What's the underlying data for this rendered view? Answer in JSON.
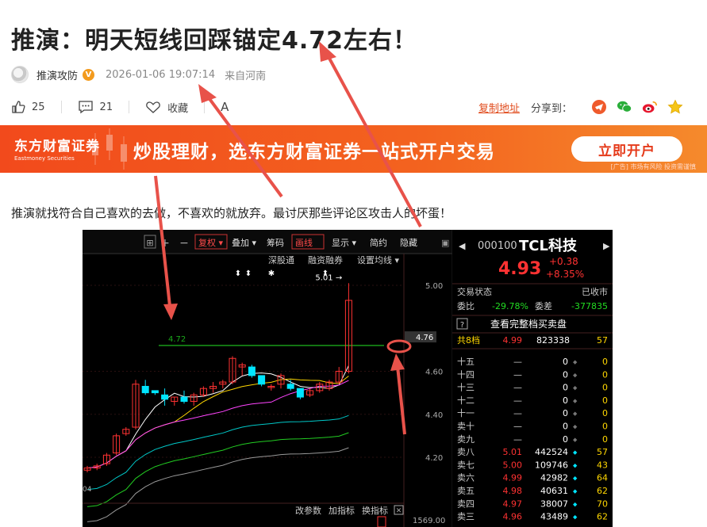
{
  "article": {
    "title": "推演：明天短线回踩锚定4.72左右！",
    "author": "推演攻防",
    "verified_badge": "V",
    "time": "2026-01-06 19:07:14",
    "location": "来自河南",
    "likes": "25",
    "comments": "21",
    "collect_label": "收藏",
    "font_size_label": "A",
    "copy_link": "复制地址",
    "share_label": "分享到："
  },
  "banner": {
    "brand_cn": "东方财富证券",
    "brand_en": "Eastmoney Securities",
    "slogan": "炒股理财，选东方财富证券一站式开户交易",
    "button": "立即开户",
    "ad_note": "[广告] 市场有风险 投资需谨慎"
  },
  "paragraph": "推演就找符合自己喜欢的去做，不喜欢的就放弃。最讨厌那些评论区攻击人的坏蛋！",
  "chart": {
    "toolbar": [
      "复权",
      "叠加",
      "筹码",
      "画线",
      "显示",
      "简约",
      "隐藏"
    ],
    "sub_toolbar": [
      "深股通",
      "融资融券",
      "设置均线"
    ],
    "top_label": "5.01",
    "line_label": "4.72",
    "y_ticks": [
      "5.00",
      "4.76",
      "4.60",
      "4.40",
      "4.20"
    ],
    "bottom_tools": [
      "改参数",
      "加指标",
      "换指标"
    ],
    "vol_label": "1569.00",
    "date_label": "04",
    "colors": {
      "up": "#ff3232",
      "down": "#00e5ff",
      "line": "#1aa81a"
    }
  },
  "chart_data": {
    "type": "candlestick",
    "ylim": [
      4.1,
      5.1
    ],
    "reference_line": 4.72,
    "high_label": 5.01,
    "candles": [
      {
        "o": 4.14,
        "h": 4.16,
        "l": 4.13,
        "c": 4.15
      },
      {
        "o": 4.15,
        "h": 4.17,
        "l": 4.14,
        "c": 4.16
      },
      {
        "o": 4.17,
        "h": 4.22,
        "l": 4.16,
        "c": 4.21
      },
      {
        "o": 4.22,
        "h": 4.31,
        "l": 4.21,
        "c": 4.3
      },
      {
        "o": 4.31,
        "h": 4.34,
        "l": 4.3,
        "c": 4.33
      },
      {
        "o": 4.34,
        "h": 4.56,
        "l": 4.33,
        "c": 4.54
      },
      {
        "o": 4.53,
        "h": 4.56,
        "l": 4.49,
        "c": 4.5
      },
      {
        "o": 4.51,
        "h": 4.51,
        "l": 4.49,
        "c": 4.5
      },
      {
        "o": 4.49,
        "h": 4.52,
        "l": 4.44,
        "c": 4.47
      },
      {
        "o": 4.46,
        "h": 4.48,
        "l": 4.44,
        "c": 4.48
      },
      {
        "o": 4.48,
        "h": 4.51,
        "l": 4.45,
        "c": 4.46
      },
      {
        "o": 4.46,
        "h": 4.5,
        "l": 4.44,
        "c": 4.49
      },
      {
        "o": 4.49,
        "h": 4.53,
        "l": 4.48,
        "c": 4.52
      },
      {
        "o": 4.52,
        "h": 4.55,
        "l": 4.5,
        "c": 4.53
      },
      {
        "o": 4.54,
        "h": 4.56,
        "l": 4.52,
        "c": 4.55
      },
      {
        "o": 4.55,
        "h": 4.67,
        "l": 4.54,
        "c": 4.66
      },
      {
        "o": 4.62,
        "h": 4.64,
        "l": 4.58,
        "c": 4.63
      },
      {
        "o": 4.62,
        "h": 4.63,
        "l": 4.57,
        "c": 4.58
      },
      {
        "o": 4.58,
        "h": 4.58,
        "l": 4.53,
        "c": 4.54
      },
      {
        "o": 4.53,
        "h": 4.54,
        "l": 4.51,
        "c": 4.53
      },
      {
        "o": 4.54,
        "h": 4.59,
        "l": 4.52,
        "c": 4.58
      },
      {
        "o": 4.54,
        "h": 4.56,
        "l": 4.51,
        "c": 4.52
      },
      {
        "o": 4.52,
        "h": 4.52,
        "l": 4.47,
        "c": 4.48
      },
      {
        "o": 4.49,
        "h": 4.52,
        "l": 4.48,
        "c": 4.51
      },
      {
        "o": 4.51,
        "h": 4.55,
        "l": 4.5,
        "c": 4.54
      },
      {
        "o": 4.52,
        "h": 4.56,
        "l": 4.51,
        "c": 4.55
      },
      {
        "o": 4.55,
        "h": 4.62,
        "l": 4.54,
        "c": 4.6
      },
      {
        "o": 4.6,
        "h": 5.01,
        "l": 4.59,
        "c": 4.93
      }
    ]
  },
  "quote": {
    "code": "000100",
    "name": "TCL科技",
    "price": "4.93",
    "change": "+0.38",
    "pct": "+8.35%",
    "status_label": "交易状态",
    "status": "已收市",
    "weibi_label": "委比",
    "weibi": "-29.78%",
    "weicha_label": "委差",
    "weicha": "-377835",
    "full_book": "查看完整档买卖盘",
    "tier_label": "共8档",
    "tier_price": "4.99",
    "tier_vol": "823338",
    "tier_cnt": "57",
    "book": [
      {
        "label": "十五",
        "price": "—",
        "vol": "0",
        "cnt": "0"
      },
      {
        "label": "十四",
        "price": "—",
        "vol": "0",
        "cnt": "0"
      },
      {
        "label": "十三",
        "price": "—",
        "vol": "0",
        "cnt": "0"
      },
      {
        "label": "十二",
        "price": "—",
        "vol": "0",
        "cnt": "0"
      },
      {
        "label": "十一",
        "price": "—",
        "vol": "0",
        "cnt": "0"
      },
      {
        "label": "卖十",
        "price": "—",
        "vol": "0",
        "cnt": "0"
      },
      {
        "label": "卖九",
        "price": "—",
        "vol": "0",
        "cnt": "0"
      },
      {
        "label": "卖八",
        "price": "5.01",
        "vol": "442524",
        "cnt": "57"
      },
      {
        "label": "卖七",
        "price": "5.00",
        "vol": "109746",
        "cnt": "43"
      },
      {
        "label": "卖六",
        "price": "4.99",
        "vol": "42982",
        "cnt": "64"
      },
      {
        "label": "卖五",
        "price": "4.98",
        "vol": "40631",
        "cnt": "62"
      },
      {
        "label": "卖四",
        "price": "4.97",
        "vol": "38007",
        "cnt": "70"
      },
      {
        "label": "卖三",
        "price": "4.96",
        "vol": "43489",
        "cnt": "62"
      }
    ]
  }
}
